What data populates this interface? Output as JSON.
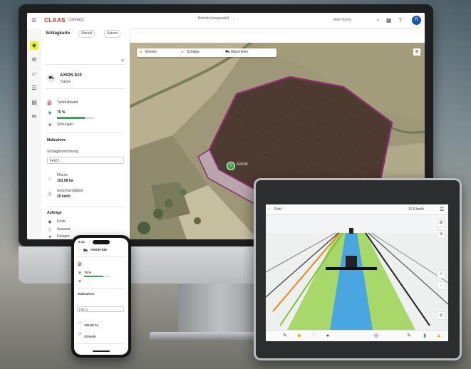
{
  "web_app": {
    "logo_text": "CLAAS",
    "app_name": "connect",
    "workspace_select": "Betrieb/Ausgewählt",
    "user_label": "Mein Konto",
    "avatar_initial": "R",
    "section_title": "Schlagkarte",
    "filter_1": "Aktuell",
    "filter_2": "Saison",
    "vehicle_name": "AXION 810",
    "vehicle_sub": "Traktor",
    "status_label": "Tankfüllstand",
    "status_value": "75 %",
    "fuel_fraction": 0.75,
    "alert_label": "Störungen",
    "group_heading": "Maßnahme",
    "field_label": "Schlagbezeichnung",
    "field_value": "Feld 1",
    "area_label": "Fläche",
    "area_value": "103,58 ha",
    "rate_label": "Geschwindigkeit",
    "rate_value": "20 km/h",
    "tasks_heading": "Aufträge",
    "task_1": "Ernte",
    "task_2": "Aussaat",
    "task_3": "Düngen",
    "map_tool_1": "Betrieb",
    "map_tool_2": "Schläge",
    "map_tool_3": "Maschinen",
    "map_marker_label": "AXION"
  },
  "tablet": {
    "top_left": "Feld",
    "top_right": "12,5 km/h"
  },
  "phone": {
    "time": "9:41",
    "title": "AXION 810",
    "status_value": "75 %",
    "group_heading": "Maßnahme",
    "field_value": "Feld 1",
    "area_value": "103,58 ha",
    "rate_value": "20 km/h"
  },
  "colors": {
    "brand": "#d52b1e",
    "accent_yellow": "#e8f03a",
    "field_outline": "#8a2f6b",
    "guidance_green": "#a9d86a",
    "guidance_blue": "#4aa6e0"
  }
}
